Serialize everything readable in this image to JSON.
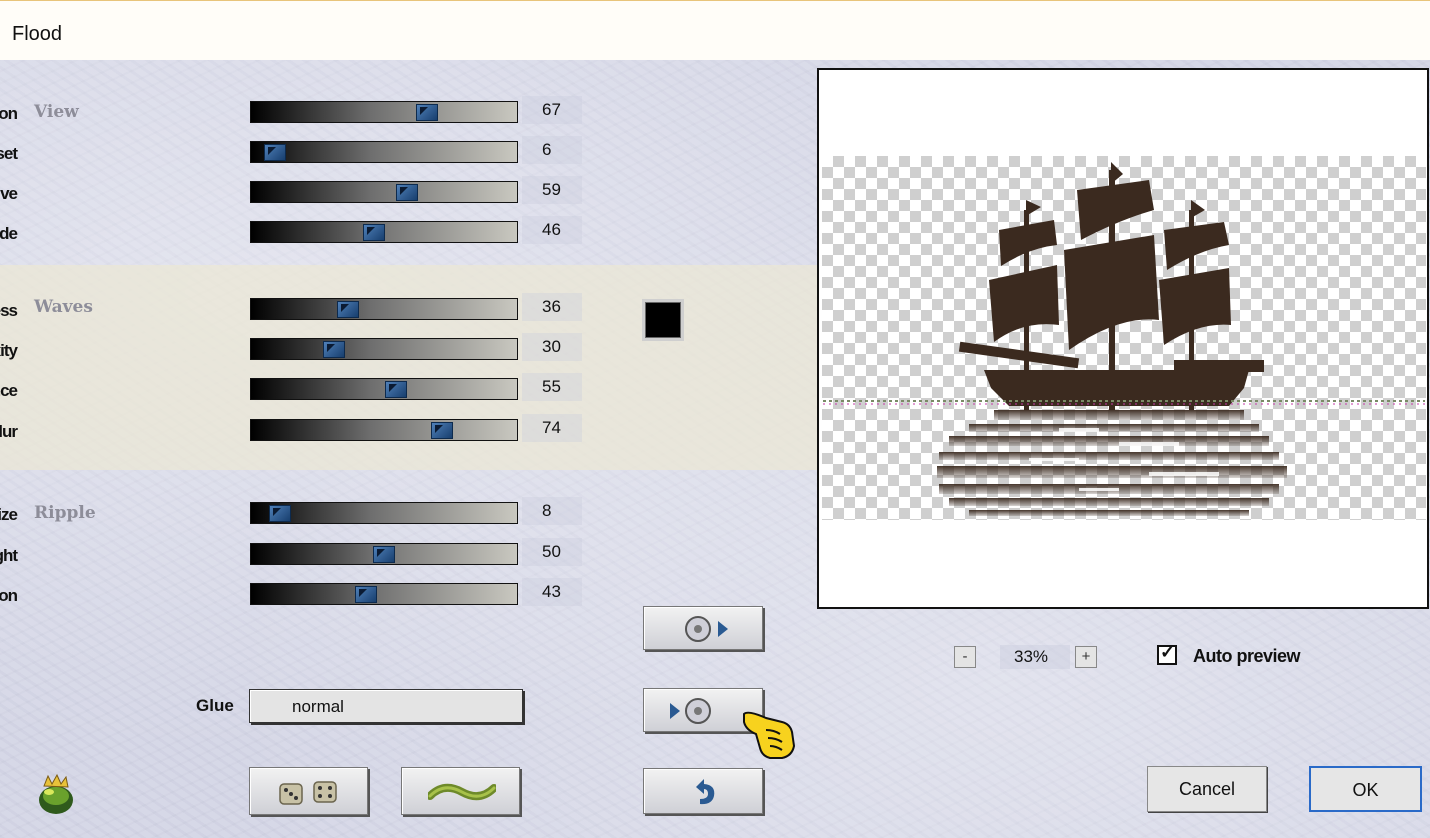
{
  "window": {
    "title": "Flood"
  },
  "groups": {
    "view": {
      "label": "View",
      "sliders": [
        {
          "label": "Horizon",
          "value": "67"
        },
        {
          "label": "Offset",
          "value": "6"
        },
        {
          "label": "Perspective",
          "value": "59"
        },
        {
          "label": "Altitude",
          "value": "46"
        }
      ]
    },
    "waves": {
      "label": "Waves",
      "color": "#000000",
      "sliders": [
        {
          "label": "Waviness",
          "value": "36"
        },
        {
          "label": "Complexity",
          "value": "30"
        },
        {
          "label": "Brilliance",
          "value": "55"
        },
        {
          "label": "Blur",
          "value": "74"
        }
      ]
    },
    "ripple": {
      "label": "Ripple",
      "sliders": [
        {
          "label": "Size",
          "value": "8"
        },
        {
          "label": "Height",
          "value": "50"
        },
        {
          "label": "Undulation",
          "value": "43"
        }
      ]
    }
  },
  "glue": {
    "label": "Glue",
    "value": "normal"
  },
  "preview": {
    "zoom_minus": "-",
    "zoom": "33%",
    "zoom_plus": "+",
    "auto_preview_label": "Auto preview",
    "auto_preview_checked": true,
    "check_mark": "✓"
  },
  "buttons": {
    "cancel": "Cancel",
    "ok": "OK",
    "icons": {
      "random": "dice-icon",
      "reset": "wave-icon",
      "load": "disc-play-icon",
      "save": "play-disc-icon",
      "undo": "undo-arrow-icon",
      "logo": "frog-logo-icon",
      "cursor": "pointing-hand-icon"
    }
  },
  "colors": {
    "accent": "#2a5a92",
    "swatch": "#000000",
    "ship": "#3b2a1f"
  }
}
